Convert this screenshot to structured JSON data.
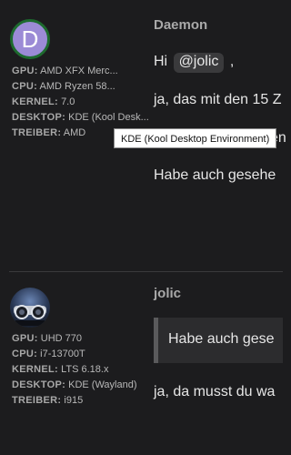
{
  "post1": {
    "avatar_letter": "D",
    "username": "Daemon",
    "specs": [
      {
        "key": "GPU:",
        "value": "AMD XFX Merc..."
      },
      {
        "key": "CPU:",
        "value": "AMD Ryzen 58..."
      },
      {
        "key": "KERNEL:",
        "value": "7.0"
      },
      {
        "key": "DESKTOP:",
        "value": "KDE (Kool Desk..."
      },
      {
        "key": "TREIBER:",
        "value": "AMD"
      }
    ],
    "greeting": "Hi",
    "mention": "@jolic",
    "greeting_after": ",",
    "line2": "ja, das mit den 15 Z",
    "line3": "en",
    "line4": "Habe auch gesehe",
    "tooltip": "KDE (Kool Desktop Environment)"
  },
  "post2": {
    "username": "jolic",
    "specs": [
      {
        "key": "GPU:",
        "value": "UHD 770"
      },
      {
        "key": "CPU:",
        "value": "i7-13700T"
      },
      {
        "key": "KERNEL:",
        "value": "LTS 6.18.x"
      },
      {
        "key": "DESKTOP:",
        "value": "KDE (Wayland)"
      },
      {
        "key": "TREIBER:",
        "value": "i915"
      }
    ],
    "quote": "Habe auch gese",
    "reply": "ja, da musst du wa"
  }
}
